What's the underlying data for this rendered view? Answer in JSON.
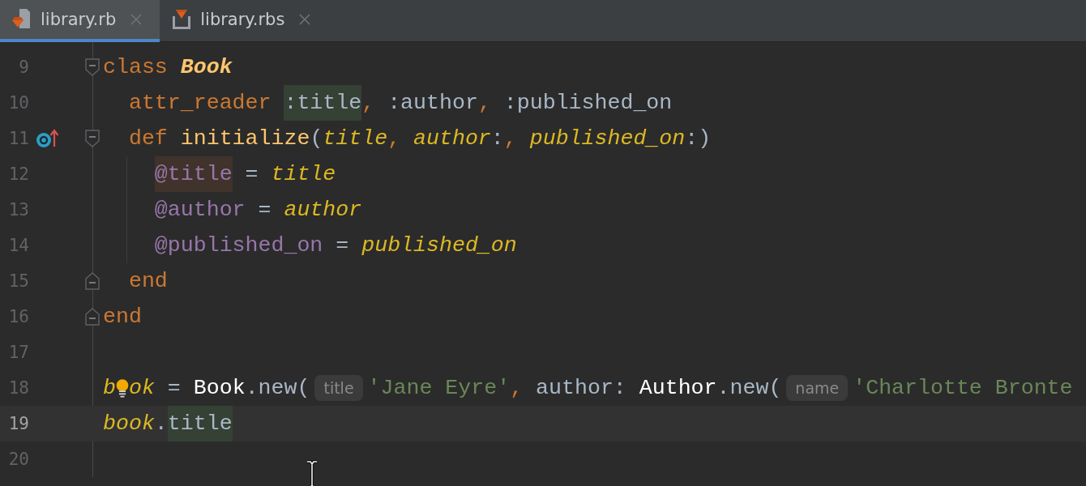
{
  "tabs": [
    {
      "label": "library.rb",
      "kind": "ruby",
      "selected": true
    },
    {
      "label": "library.rbs",
      "kind": "rbs",
      "selected": false
    }
  ],
  "lines": [
    {
      "number": "9",
      "current": false,
      "fold_start": true,
      "guide": false,
      "tokens": [
        {
          "text": "class ",
          "kind": "keyword"
        },
        {
          "text": "Book",
          "kind": "classname"
        }
      ]
    },
    {
      "number": "10",
      "current": false,
      "guide": false,
      "tokens": [
        {
          "text": "  attr_reader ",
          "kind": "keyword"
        },
        {
          "text": ":title",
          "kind": "symbol",
          "usage_highlight": true
        },
        {
          "text": ",",
          "kind": "punct"
        },
        {
          "text": " :author",
          "kind": "symbol"
        },
        {
          "text": ",",
          "kind": "punct"
        },
        {
          "text": " :published_on",
          "kind": "symbol"
        }
      ]
    },
    {
      "number": "11",
      "current": false,
      "fold_start": true,
      "override": true,
      "guide": false,
      "tokens": [
        {
          "text": "  def ",
          "kind": "keyword"
        },
        {
          "text": "initialize",
          "kind": "method"
        },
        {
          "text": "(",
          "kind": "plain"
        },
        {
          "text": "title",
          "kind": "param"
        },
        {
          "text": ", ",
          "kind": "punct"
        },
        {
          "text": "author",
          "kind": "param"
        },
        {
          "text": ":",
          "kind": "plain"
        },
        {
          "text": ", ",
          "kind": "punct"
        },
        {
          "text": "published_on",
          "kind": "param"
        },
        {
          "text": ":)",
          "kind": "plain"
        }
      ]
    },
    {
      "number": "12",
      "current": false,
      "guide": true,
      "tokens": [
        {
          "text": "    @title",
          "kind": "ivar",
          "write_highlight": true
        },
        {
          "text": " = ",
          "kind": "plain"
        },
        {
          "text": "title",
          "kind": "param"
        }
      ]
    },
    {
      "number": "13",
      "current": false,
      "guide": true,
      "tokens": [
        {
          "text": "    @author",
          "kind": "ivar"
        },
        {
          "text": " = ",
          "kind": "plain"
        },
        {
          "text": "author",
          "kind": "param"
        }
      ]
    },
    {
      "number": "14",
      "current": false,
      "guide": true,
      "tokens": [
        {
          "text": "    @published_on",
          "kind": "ivar"
        },
        {
          "text": " = ",
          "kind": "plain"
        },
        {
          "text": "published_on",
          "kind": "param"
        }
      ]
    },
    {
      "number": "15",
      "current": false,
      "fold_end": true,
      "guide": false,
      "tokens": [
        {
          "text": "  end",
          "kind": "keyword"
        }
      ]
    },
    {
      "number": "16",
      "current": false,
      "fold_end": true,
      "guide": false,
      "tokens": [
        {
          "text": "end",
          "kind": "keyword"
        }
      ]
    },
    {
      "number": "17",
      "current": false,
      "guide": false
    },
    {
      "number": "18",
      "current": false,
      "guide": false,
      "tokens": [
        {
          "text": "b",
          "kind": "local"
        },
        {
          "kind": "lightbulb"
        },
        {
          "text": "ok",
          "kind": "local"
        },
        {
          "text": " = ",
          "kind": "plain"
        },
        {
          "text": "Book",
          "kind": "constant"
        },
        {
          "text": ".new(",
          "kind": "plain"
        },
        {
          "text": "title",
          "kind": "hint"
        },
        {
          "text": "'Jane Eyre'",
          "kind": "string"
        },
        {
          "text": ",",
          "kind": "punct"
        },
        {
          "text": " author: ",
          "kind": "plain"
        },
        {
          "text": "Author",
          "kind": "constant"
        },
        {
          "text": ".new(",
          "kind": "plain"
        },
        {
          "text": "name",
          "kind": "hint"
        },
        {
          "text": "'Charlotte Bronte",
          "kind": "string"
        }
      ]
    },
    {
      "number": "19",
      "current": true,
      "guide": false,
      "tokens": [
        {
          "text": "book",
          "kind": "local"
        },
        {
          "text": ".",
          "kind": "plain"
        },
        {
          "text": "title",
          "kind": "plain",
          "usage_highlight": true
        }
      ]
    },
    {
      "number": "20",
      "current": false,
      "guide": false
    }
  ]
}
